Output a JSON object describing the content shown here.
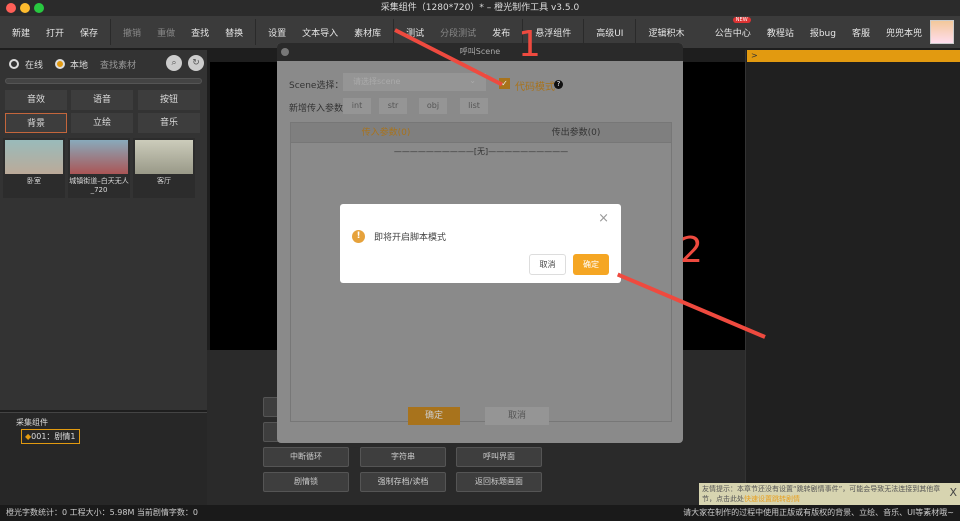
{
  "window": {
    "title": "采集组件（1280*720）* – 橙光制作工具 v3.5.0"
  },
  "toolbar": {
    "items": [
      "新建",
      "打开",
      "保存",
      "撤销",
      "重做",
      "查找",
      "替换",
      "设置",
      "文本导入",
      "素材库",
      "测试",
      "分段测试",
      "发布",
      "悬浮组件",
      "高级UI",
      "逻辑积木"
    ],
    "right": [
      "公告中心",
      "教程站",
      "报bug",
      "客服",
      "兜兜本兜"
    ],
    "new_badge": "NEW"
  },
  "left": {
    "online": "在线",
    "local": "本地",
    "search_placeholder": "查找素材",
    "categories": [
      "音效",
      "语音",
      "按钮",
      "背景",
      "立绘",
      "音乐"
    ],
    "assets": [
      "卧室",
      "城镇街道–白天无人_720",
      "客厅"
    ]
  },
  "tree": {
    "root": "采集组件",
    "item": "001：剧情1"
  },
  "blocks": [
    "中断循环",
    "字符串",
    "呼叫界面",
    "剧情锁",
    "强制存档/读档",
    "返回标题画面"
  ],
  "console": {
    "prompt": ">"
  },
  "dialog": {
    "title": "呼叫Scene",
    "scene_label": "Scene选择：",
    "scene_placeholder": "请选择scene",
    "code_mode": "代码模式",
    "help": "?",
    "param_label": "新增传入参数：",
    "param_buttons": [
      "int",
      "str",
      "obj",
      "list"
    ],
    "tab_in": "传入参数(0)",
    "tab_out": "传出参数(0)",
    "empty": "——————————[无]——————————",
    "ok": "确定",
    "cancel": "取消"
  },
  "alert": {
    "message": "即将开启脚本模式",
    "cancel": "取消",
    "ok": "确定",
    "close": "×"
  },
  "annotations": {
    "step1": "1",
    "step2": "2"
  },
  "tip": {
    "prefix": "友情提示：",
    "text": "本章节还没有设置“跳转剧情事件”，可能会导致无法连接到其他章节，点击此处",
    "link": "快速设置跳转剧情",
    "close": "X"
  },
  "status": {
    "left": "橙光字数统计：0 工程大小：5.98M 当前剧情字数：0",
    "right": "请大家在制作的过程中使用正版或有版权的背景、立绘、音乐、UI等素材哦~"
  },
  "colors": {
    "accent": "#e29a10",
    "arrow": "#ee4a3f"
  }
}
